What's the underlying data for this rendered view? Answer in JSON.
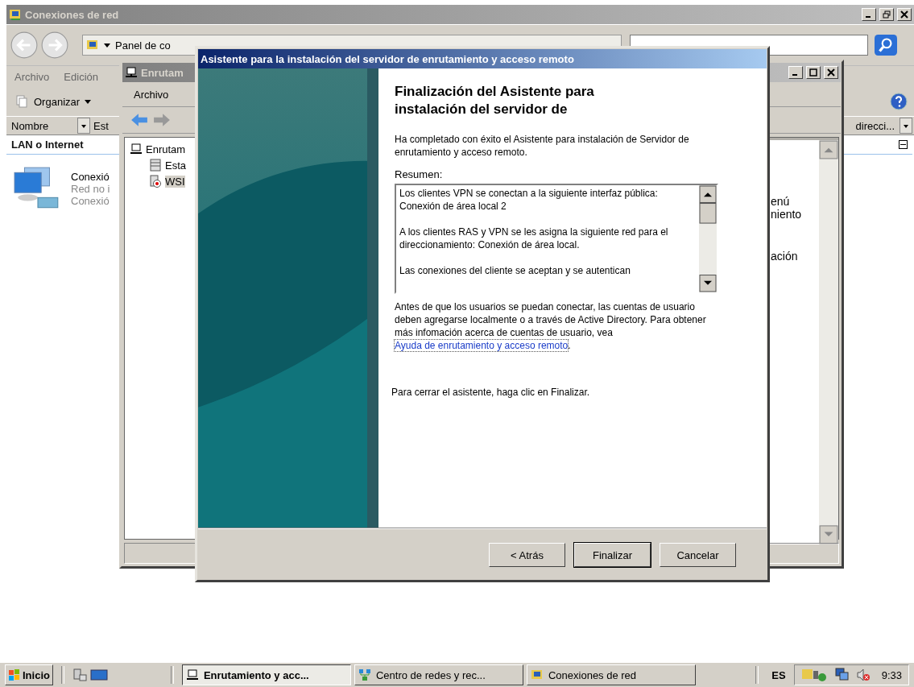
{
  "explorer": {
    "title": "Conexiones de red",
    "address": "Panel de co",
    "menu": [
      "Archivo",
      "Edición"
    ],
    "organize": "Organizar",
    "columns": [
      "Nombre",
      "Est"
    ],
    "column_right": "direcci...",
    "group": "LAN o Internet",
    "item_lines": [
      "Conexió",
      "Red no i",
      "Conexió"
    ]
  },
  "mmc": {
    "title": "Enrutam",
    "menu": [
      "Archivo"
    ],
    "tree": [
      {
        "label": "Enrutam",
        "expanded": true,
        "selected": false,
        "children": [
          {
            "label": "Esta",
            "kind": "server",
            "selected": false
          },
          {
            "label": "WSI",
            "kind": "router",
            "selected": true
          }
        ]
      }
    ],
    "pane_lines": [
      "enú",
      "niento",
      "ación"
    ]
  },
  "wizard": {
    "title": "Asistente para la instalación del servidor de enrutamiento y acceso remoto",
    "heading_lines": [
      "Finalización del Asistente para",
      "instalación del servidor de"
    ],
    "intro": "Ha completado con éxito el Asistente para instalación de Servidor de enrutamiento y acceso remoto.",
    "summary_label": "Resumen:",
    "summary": [
      "Los clientes VPN se conectan a la siguiente interfaz pública: Conexión de área local 2",
      "A los clientes RAS y VPN se les asigna la siguiente red para el direccionamiento: Conexión de área local.",
      "Las conexiones del cliente se aceptan y se autentican"
    ],
    "note": "Antes de que los usuarios se puedan conectar, las cuentas de usuario deben agregarse localmente o a través de Active Directory. Para obtener más infomación acerca de cuentas de usuario, vea ",
    "link": "Ayuda de enrutamiento y acceso remoto",
    "note_end": ".",
    "closing": "Para cerrar el asistente, haga clic en Finalizar.",
    "buttons": [
      {
        "label": "< Atrás",
        "default": false
      },
      {
        "label": "Finalizar",
        "default": true
      },
      {
        "label": "Cancelar",
        "default": false
      }
    ]
  },
  "taskbar": {
    "start": "Inicio",
    "tasks": [
      {
        "label": "Enrutamiento y acc...",
        "kind": "router",
        "selected": true
      },
      {
        "label": "Centro de redes y rec...",
        "kind": "network",
        "selected": false
      },
      {
        "label": "Conexiones de red",
        "kind": "connections",
        "selected": false
      }
    ],
    "language": "ES",
    "clock": "9:33"
  }
}
